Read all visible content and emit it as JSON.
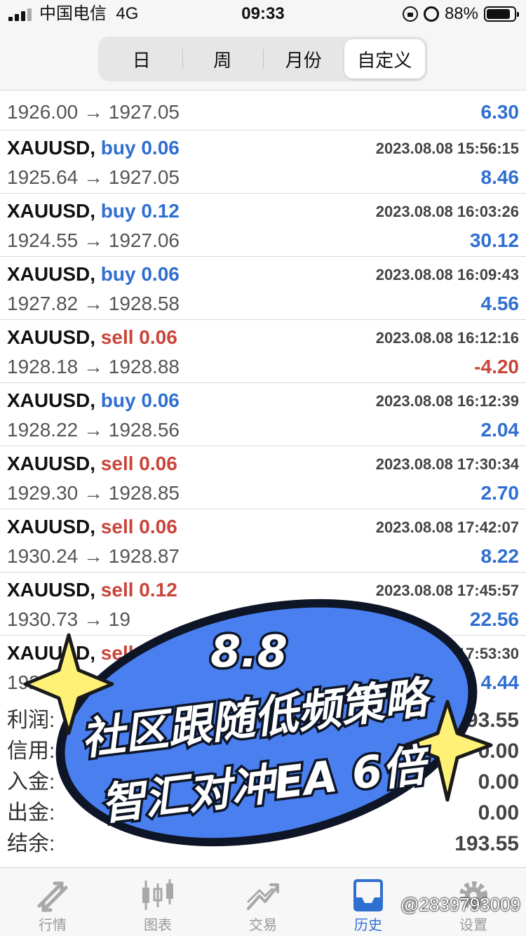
{
  "status_bar": {
    "carrier": "中国电信",
    "network": "4G",
    "time": "09:33",
    "battery": "88%"
  },
  "period_tabs": [
    {
      "label": "日",
      "active": false
    },
    {
      "label": "周",
      "active": false
    },
    {
      "label": "月份",
      "active": false
    },
    {
      "label": "自定义",
      "active": true
    }
  ],
  "trades": [
    {
      "symbol": "XAUUSD,",
      "side": "buy",
      "volume": "0.06",
      "time": "2023.08.08 15:56:15",
      "prices": "1925.64 → 1927.05",
      "profit": "8.46"
    },
    {
      "symbol": "XAUUSD,",
      "side": "buy",
      "volume": "0.12",
      "time": "2023.08.08 16:03:26",
      "prices": "1924.55 → 1927.06",
      "profit": "30.12"
    },
    {
      "symbol": "XAUUSD,",
      "side": "buy",
      "volume": "0.06",
      "time": "2023.08.08 16:09:43",
      "prices": "1927.82 → 1928.58",
      "profit": "4.56"
    },
    {
      "symbol": "XAUUSD,",
      "side": "sell",
      "volume": "0.06",
      "time": "2023.08.08 16:12:16",
      "prices": "1928.18 → 1928.88",
      "profit": "-4.20"
    },
    {
      "symbol": "XAUUSD,",
      "side": "buy",
      "volume": "0.06",
      "time": "2023.08.08 16:12:39",
      "prices": "1928.22 → 1928.56",
      "profit": "2.04"
    },
    {
      "symbol": "XAUUSD,",
      "side": "sell",
      "volume": "0.06",
      "time": "2023.08.08 17:30:34",
      "prices": "1929.30 → 1928.85",
      "profit": "2.70"
    },
    {
      "symbol": "XAUUSD,",
      "side": "sell",
      "volume": "0.06",
      "time": "2023.08.08 17:42:07",
      "prices": "1930.24 → 1928.87",
      "profit": "8.22"
    },
    {
      "symbol": "XAUUSD,",
      "side": "sell",
      "volume": "0.12",
      "time": "2023.08.08 17:45:57",
      "prices": "1930.73 → 19",
      "profit": "22.56"
    },
    {
      "symbol": "XAUUSD,",
      "side": "sell",
      "volume": "",
      "time": "08 17:53:30",
      "prices": "1927",
      "profit": "4.44"
    }
  ],
  "partial_top": {
    "prices": "1926.00 → 1927.05",
    "profit": "6.30"
  },
  "summary": [
    {
      "label": "利润:",
      "value": "193.55"
    },
    {
      "label": "信用:",
      "value": "0.00"
    },
    {
      "label": "入金:",
      "value": "0.00"
    },
    {
      "label": "出金:",
      "value": "0.00"
    },
    {
      "label": "结余:",
      "value": "193.55"
    }
  ],
  "promo": {
    "line1": "8.8",
    "line2": "社区跟随低频策略",
    "line3": "智汇对冲EA 6倍",
    "fill_color": "#4a7ff0",
    "border_color": "#0d1526"
  },
  "tabbar": [
    {
      "label": "行情",
      "icon": "quotes-icon",
      "active": false
    },
    {
      "label": "图表",
      "icon": "chart-icon",
      "active": false
    },
    {
      "label": "交易",
      "icon": "trade-icon",
      "active": false
    },
    {
      "label": "历史",
      "icon": "history-icon",
      "active": true
    },
    {
      "label": "设置",
      "icon": "gear-icon",
      "active": false
    }
  ],
  "watermark": "@2839793009",
  "colors": {
    "buy": "#2f6fd1",
    "sell": "#c9443a",
    "accent": "#2f6fd1"
  }
}
